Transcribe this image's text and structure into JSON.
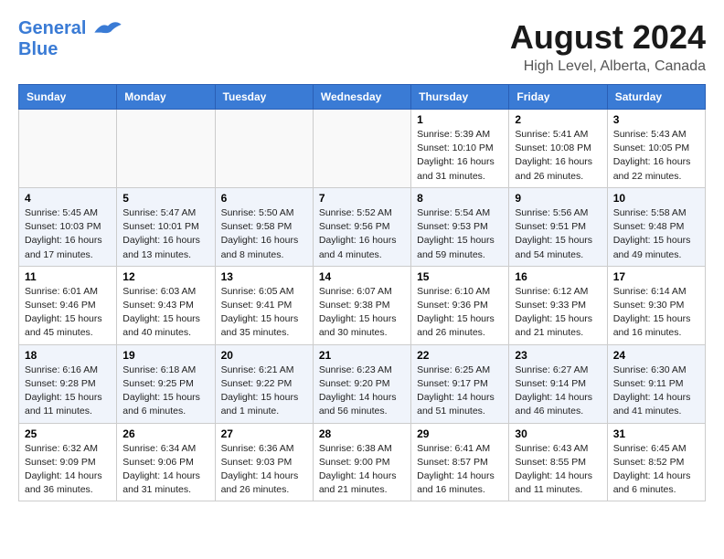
{
  "header": {
    "logo_line1": "General",
    "logo_line2": "Blue",
    "month_year": "August 2024",
    "location": "High Level, Alberta, Canada"
  },
  "days_of_week": [
    "Sunday",
    "Monday",
    "Tuesday",
    "Wednesday",
    "Thursday",
    "Friday",
    "Saturday"
  ],
  "weeks": [
    [
      {
        "day": "",
        "info": ""
      },
      {
        "day": "",
        "info": ""
      },
      {
        "day": "",
        "info": ""
      },
      {
        "day": "",
        "info": ""
      },
      {
        "day": "1",
        "info": "Sunrise: 5:39 AM\nSunset: 10:10 PM\nDaylight: 16 hours\nand 31 minutes."
      },
      {
        "day": "2",
        "info": "Sunrise: 5:41 AM\nSunset: 10:08 PM\nDaylight: 16 hours\nand 26 minutes."
      },
      {
        "day": "3",
        "info": "Sunrise: 5:43 AM\nSunset: 10:05 PM\nDaylight: 16 hours\nand 22 minutes."
      }
    ],
    [
      {
        "day": "4",
        "info": "Sunrise: 5:45 AM\nSunset: 10:03 PM\nDaylight: 16 hours\nand 17 minutes."
      },
      {
        "day": "5",
        "info": "Sunrise: 5:47 AM\nSunset: 10:01 PM\nDaylight: 16 hours\nand 13 minutes."
      },
      {
        "day": "6",
        "info": "Sunrise: 5:50 AM\nSunset: 9:58 PM\nDaylight: 16 hours\nand 8 minutes."
      },
      {
        "day": "7",
        "info": "Sunrise: 5:52 AM\nSunset: 9:56 PM\nDaylight: 16 hours\nand 4 minutes."
      },
      {
        "day": "8",
        "info": "Sunrise: 5:54 AM\nSunset: 9:53 PM\nDaylight: 15 hours\nand 59 minutes."
      },
      {
        "day": "9",
        "info": "Sunrise: 5:56 AM\nSunset: 9:51 PM\nDaylight: 15 hours\nand 54 minutes."
      },
      {
        "day": "10",
        "info": "Sunrise: 5:58 AM\nSunset: 9:48 PM\nDaylight: 15 hours\nand 49 minutes."
      }
    ],
    [
      {
        "day": "11",
        "info": "Sunrise: 6:01 AM\nSunset: 9:46 PM\nDaylight: 15 hours\nand 45 minutes."
      },
      {
        "day": "12",
        "info": "Sunrise: 6:03 AM\nSunset: 9:43 PM\nDaylight: 15 hours\nand 40 minutes."
      },
      {
        "day": "13",
        "info": "Sunrise: 6:05 AM\nSunset: 9:41 PM\nDaylight: 15 hours\nand 35 minutes."
      },
      {
        "day": "14",
        "info": "Sunrise: 6:07 AM\nSunset: 9:38 PM\nDaylight: 15 hours\nand 30 minutes."
      },
      {
        "day": "15",
        "info": "Sunrise: 6:10 AM\nSunset: 9:36 PM\nDaylight: 15 hours\nand 26 minutes."
      },
      {
        "day": "16",
        "info": "Sunrise: 6:12 AM\nSunset: 9:33 PM\nDaylight: 15 hours\nand 21 minutes."
      },
      {
        "day": "17",
        "info": "Sunrise: 6:14 AM\nSunset: 9:30 PM\nDaylight: 15 hours\nand 16 minutes."
      }
    ],
    [
      {
        "day": "18",
        "info": "Sunrise: 6:16 AM\nSunset: 9:28 PM\nDaylight: 15 hours\nand 11 minutes."
      },
      {
        "day": "19",
        "info": "Sunrise: 6:18 AM\nSunset: 9:25 PM\nDaylight: 15 hours\nand 6 minutes."
      },
      {
        "day": "20",
        "info": "Sunrise: 6:21 AM\nSunset: 9:22 PM\nDaylight: 15 hours\nand 1 minute."
      },
      {
        "day": "21",
        "info": "Sunrise: 6:23 AM\nSunset: 9:20 PM\nDaylight: 14 hours\nand 56 minutes."
      },
      {
        "day": "22",
        "info": "Sunrise: 6:25 AM\nSunset: 9:17 PM\nDaylight: 14 hours\nand 51 minutes."
      },
      {
        "day": "23",
        "info": "Sunrise: 6:27 AM\nSunset: 9:14 PM\nDaylight: 14 hours\nand 46 minutes."
      },
      {
        "day": "24",
        "info": "Sunrise: 6:30 AM\nSunset: 9:11 PM\nDaylight: 14 hours\nand 41 minutes."
      }
    ],
    [
      {
        "day": "25",
        "info": "Sunrise: 6:32 AM\nSunset: 9:09 PM\nDaylight: 14 hours\nand 36 minutes."
      },
      {
        "day": "26",
        "info": "Sunrise: 6:34 AM\nSunset: 9:06 PM\nDaylight: 14 hours\nand 31 minutes."
      },
      {
        "day": "27",
        "info": "Sunrise: 6:36 AM\nSunset: 9:03 PM\nDaylight: 14 hours\nand 26 minutes."
      },
      {
        "day": "28",
        "info": "Sunrise: 6:38 AM\nSunset: 9:00 PM\nDaylight: 14 hours\nand 21 minutes."
      },
      {
        "day": "29",
        "info": "Sunrise: 6:41 AM\nSunset: 8:57 PM\nDaylight: 14 hours\nand 16 minutes."
      },
      {
        "day": "30",
        "info": "Sunrise: 6:43 AM\nSunset: 8:55 PM\nDaylight: 14 hours\nand 11 minutes."
      },
      {
        "day": "31",
        "info": "Sunrise: 6:45 AM\nSunset: 8:52 PM\nDaylight: 14 hours\nand 6 minutes."
      }
    ]
  ]
}
